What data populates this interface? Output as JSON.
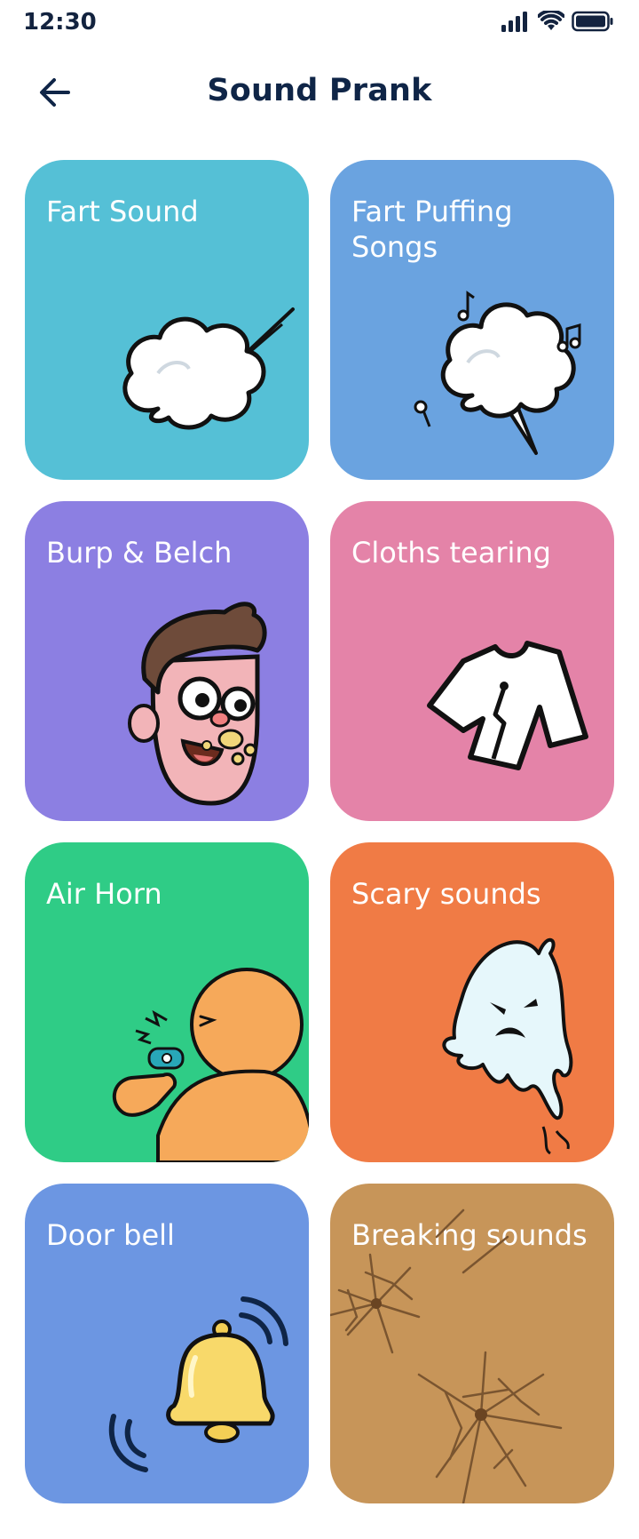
{
  "status_bar": {
    "time": "12:30"
  },
  "header": {
    "title": "Sound Prank"
  },
  "cards": [
    {
      "label": "Fart Sound",
      "color": "#55c0d6",
      "art": "fart-cloud-icon"
    },
    {
      "label": "Fart Puffing Songs",
      "color": "#6aa3e0",
      "art": "music-cloud-icon"
    },
    {
      "label": "Burp & Belch",
      "color": "#8c7fe2",
      "art": "burping-face-icon"
    },
    {
      "label": "Cloths tearing",
      "color": "#e483a8",
      "art": "torn-shirt-icon"
    },
    {
      "label": "Air Horn",
      "color": "#2fcc86",
      "art": "whistle-person-icon"
    },
    {
      "label": "Scary sounds",
      "color": "#f07b45",
      "art": "ghost-icon"
    },
    {
      "label": "Door bell",
      "color": "#6c96e2",
      "art": "bell-icon"
    },
    {
      "label": "Breaking sounds",
      "color": "#c79559",
      "art": "cracked-glass-icon"
    }
  ]
}
